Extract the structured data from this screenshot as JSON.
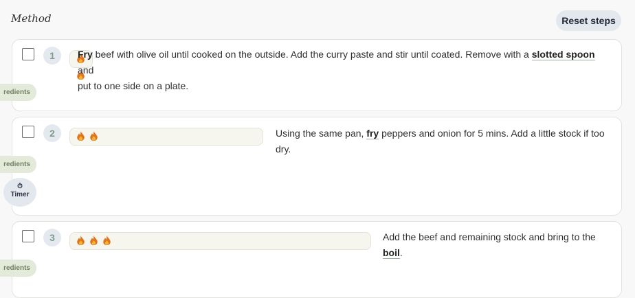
{
  "header": {
    "title": "Method",
    "reset_label": "Reset steps"
  },
  "colors": {
    "accent": "#9ab09a",
    "pill": "#e3eada",
    "timer": "#e3e8ef",
    "flame_outer": "#e0741e",
    "flame_inner": "#f2b531"
  },
  "side": {
    "ingredients_label": "redients",
    "timer_label": "Timer",
    "timer_icon": "stopwatch-icon"
  },
  "steps": [
    {
      "number": "1",
      "heat_level": 2,
      "text": {
        "t1": "Fry",
        "t2": " beef with olive oil until cooked on the outside. Add the curry paste and stir until coated. Remove with a ",
        "t3": "slotted spoon",
        "t4": " and",
        "t5": "put to one side on a plate."
      }
    },
    {
      "number": "2",
      "heat_level": 2,
      "text": {
        "t1": "Using the same pan, ",
        "t2": "fry",
        "t3": " peppers and onion for 5 mins. Add a little stock if too dry."
      }
    },
    {
      "number": "3",
      "heat_level": 3,
      "text": {
        "t1": "Add the beef and remaining stock and bring to the ",
        "t2": "boil",
        "t3": "."
      }
    }
  ]
}
